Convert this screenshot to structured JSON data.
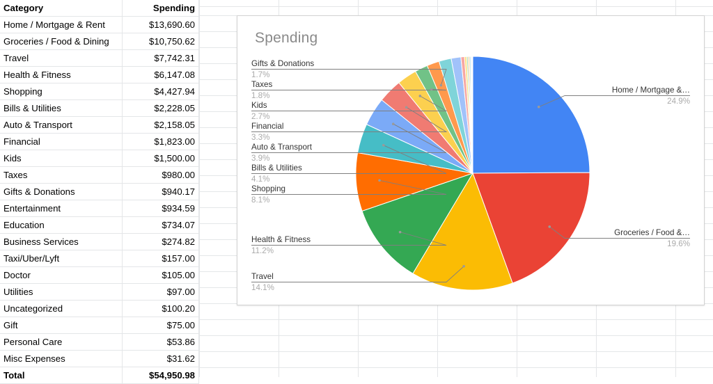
{
  "spreadsheet": {
    "table": {
      "headers": [
        "Category",
        "Spending"
      ],
      "rows": [
        {
          "category": "Home / Mortgage & Rent",
          "amount": "$13,690.60"
        },
        {
          "category": "Groceries / Food & Dining",
          "amount": "$10,750.62"
        },
        {
          "category": "Travel",
          "amount": "$7,742.31"
        },
        {
          "category": "Health & Fitness",
          "amount": "$6,147.08"
        },
        {
          "category": "Shopping",
          "amount": "$4,427.94"
        },
        {
          "category": "Bills & Utilities",
          "amount": "$2,228.05"
        },
        {
          "category": "Auto & Transport",
          "amount": "$2,158.05"
        },
        {
          "category": "Financial",
          "amount": "$1,823.00"
        },
        {
          "category": "Kids",
          "amount": "$1,500.00"
        },
        {
          "category": "Taxes",
          "amount": "$980.00"
        },
        {
          "category": "Gifts & Donations",
          "amount": "$940.17"
        },
        {
          "category": "Entertainment",
          "amount": "$934.59"
        },
        {
          "category": "Education",
          "amount": "$734.07"
        },
        {
          "category": "Business Services",
          "amount": "$274.82"
        },
        {
          "category": "Taxi/Uber/Lyft",
          "amount": "$157.00"
        },
        {
          "category": "Doctor",
          "amount": "$105.00"
        },
        {
          "category": "Utilities",
          "amount": "$97.00"
        },
        {
          "category": "Uncategorized",
          "amount": "$100.20"
        },
        {
          "category": "Gift",
          "amount": "$75.00"
        },
        {
          "category": "Personal Care",
          "amount": "$53.86"
        },
        {
          "category": "Misc Expenses",
          "amount": "$31.62"
        }
      ],
      "total": {
        "category": "Total",
        "amount": "$54,950.98"
      }
    }
  },
  "chart_data": {
    "type": "pie",
    "title": "Spending",
    "xlabel": "",
    "ylabel": "",
    "legend_position": "none",
    "label_style": "outside-with-leader-lines",
    "start_angle_deg": 0,
    "direction": "clockwise",
    "categories": [
      "Home / Mortgage & Rent",
      "Groceries / Food & Dining",
      "Travel",
      "Health & Fitness",
      "Shopping",
      "Bills & Utilities",
      "Auto & Transport",
      "Financial",
      "Kids",
      "Taxes",
      "Gifts & Donations",
      "Entertainment",
      "Education",
      "Business Services",
      "Taxi/Uber/Lyft",
      "Doctor",
      "Uncategorized",
      "Utilities",
      "Gift",
      "Personal Care",
      "Misc Expenses"
    ],
    "values": [
      13690.6,
      10750.62,
      7742.31,
      6147.08,
      4427.94,
      2228.05,
      2158.05,
      1823.0,
      1500.0,
      980.0,
      940.17,
      934.59,
      734.07,
      274.82,
      157.0,
      105.0,
      100.2,
      97.0,
      75.0,
      53.86,
      31.62
    ],
    "percents": [
      24.9,
      19.6,
      14.1,
      11.2,
      8.1,
      4.1,
      3.9,
      3.3,
      2.7,
      1.8,
      1.7,
      1.7,
      1.3,
      0.5,
      0.3,
      0.2,
      0.2,
      0.2,
      0.1,
      0.1,
      0.1
    ],
    "colors": [
      "#4285F4",
      "#EA4335",
      "#FBBC04",
      "#34A853",
      "#FF6D01",
      "#46BDC6",
      "#7BAAF7",
      "#F07B72",
      "#FCD04F",
      "#71C287",
      "#FF994D",
      "#7FD4D9",
      "#A1C2FA",
      "#F7A7A3",
      "#FDDF7E",
      "#9CD6AC",
      "#FFB97D",
      "#AADFE3",
      "#C1D4FB",
      "#FAC5C2",
      "#FEEBA6"
    ],
    "total": 54950.98,
    "visible_labels": [
      {
        "name": "Gifts & Donations",
        "pct": "1.7%"
      },
      {
        "name": "Taxes",
        "pct": "1.8%"
      },
      {
        "name": "Kids",
        "pct": "2.7%"
      },
      {
        "name": "Financial",
        "pct": "3.3%"
      },
      {
        "name": "Auto & Transport",
        "pct": "3.9%"
      },
      {
        "name": "Bills & Utilities",
        "pct": "4.1%"
      },
      {
        "name": "Shopping",
        "pct": "8.1%"
      },
      {
        "name": "Health & Fitness",
        "pct": "11.2%"
      },
      {
        "name": "Travel",
        "pct": "14.1%"
      },
      {
        "name": "Home / Mortgage &…",
        "pct": "24.9%"
      },
      {
        "name": "Groceries / Food &…",
        "pct": "19.6%"
      }
    ]
  }
}
